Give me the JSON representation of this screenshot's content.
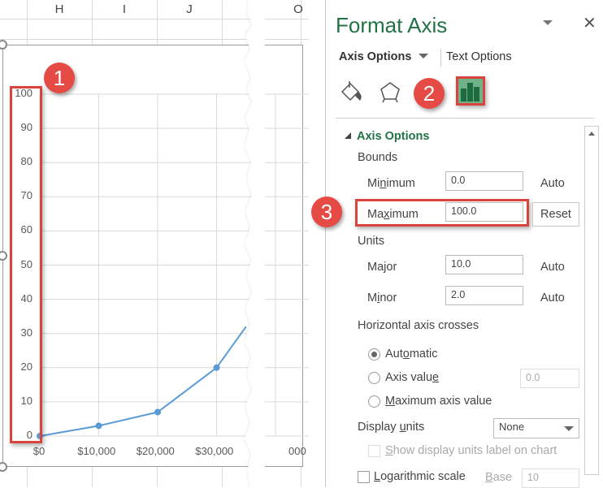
{
  "spreadsheet": {
    "column_headers": [
      "H",
      "I",
      "J",
      "",
      "O"
    ]
  },
  "chart_data": {
    "type": "line",
    "title": "",
    "xlabel": "",
    "ylabel": "",
    "x": [
      0,
      10000,
      20000,
      30000,
      35000
    ],
    "values": [
      0,
      3,
      7,
      20,
      32
    ],
    "x_tick_labels": [
      "$0",
      "$10,000",
      "$20,000",
      "$30,000",
      "000"
    ],
    "y_tick_labels": [
      "0",
      "10",
      "20",
      "30",
      "40",
      "50",
      "60",
      "70",
      "80",
      "90",
      "100"
    ],
    "ylim": [
      0,
      100
    ],
    "grid": true,
    "series_color": "#5b9bd5"
  },
  "annotations": {
    "badge1": "1",
    "badge2": "2",
    "badge3": "3",
    "highlight_color": "#d9443f"
  },
  "panel": {
    "title": "Format Axis",
    "tabs": {
      "axis_options": "Axis Options",
      "text_options": "Text Options"
    },
    "section_title": "Axis Options",
    "bounds_label": "Bounds",
    "minimum": {
      "label_pre": "Mi",
      "label_u": "n",
      "label_post": "imum",
      "value": "0.0",
      "state": "Auto"
    },
    "maximum": {
      "label_pre": "Ma",
      "label_u": "x",
      "label_post": "imum",
      "value": "100.0",
      "state": "Reset"
    },
    "units_label": "Units",
    "major": {
      "label_pre": "Ma",
      "label_u": "j",
      "label_post": "or",
      "value": "10.0",
      "state": "Auto"
    },
    "minor": {
      "label_pre": "M",
      "label_u": "i",
      "label_post": "nor",
      "value": "2.0",
      "state": "Auto"
    },
    "horizontal_axis_crosses": "Horizontal axis crosses",
    "crosses_options": {
      "automatic": {
        "pre": "Aut",
        "u": "o",
        "post": "matic",
        "selected": true
      },
      "axis_value": {
        "pre": "Axis valu",
        "u": "e",
        "post": "",
        "value": "0.0",
        "selected": false
      },
      "maximum_axis_value": {
        "pre": "",
        "u": "M",
        "post": "aximum axis value",
        "selected": false
      }
    },
    "display_units": {
      "pre": "Display ",
      "u": "u",
      "post": "nits",
      "value": "None"
    },
    "show_units_label": {
      "pre": "",
      "u": "S",
      "post": "how display units label on chart",
      "checked": false
    },
    "log_scale": {
      "pre": "",
      "u": "L",
      "post": "ogarithmic scale",
      "checked": false,
      "base_label_u": "B",
      "base_label_post": "ase",
      "base_value": "10"
    },
    "accent_color": "#217346"
  }
}
